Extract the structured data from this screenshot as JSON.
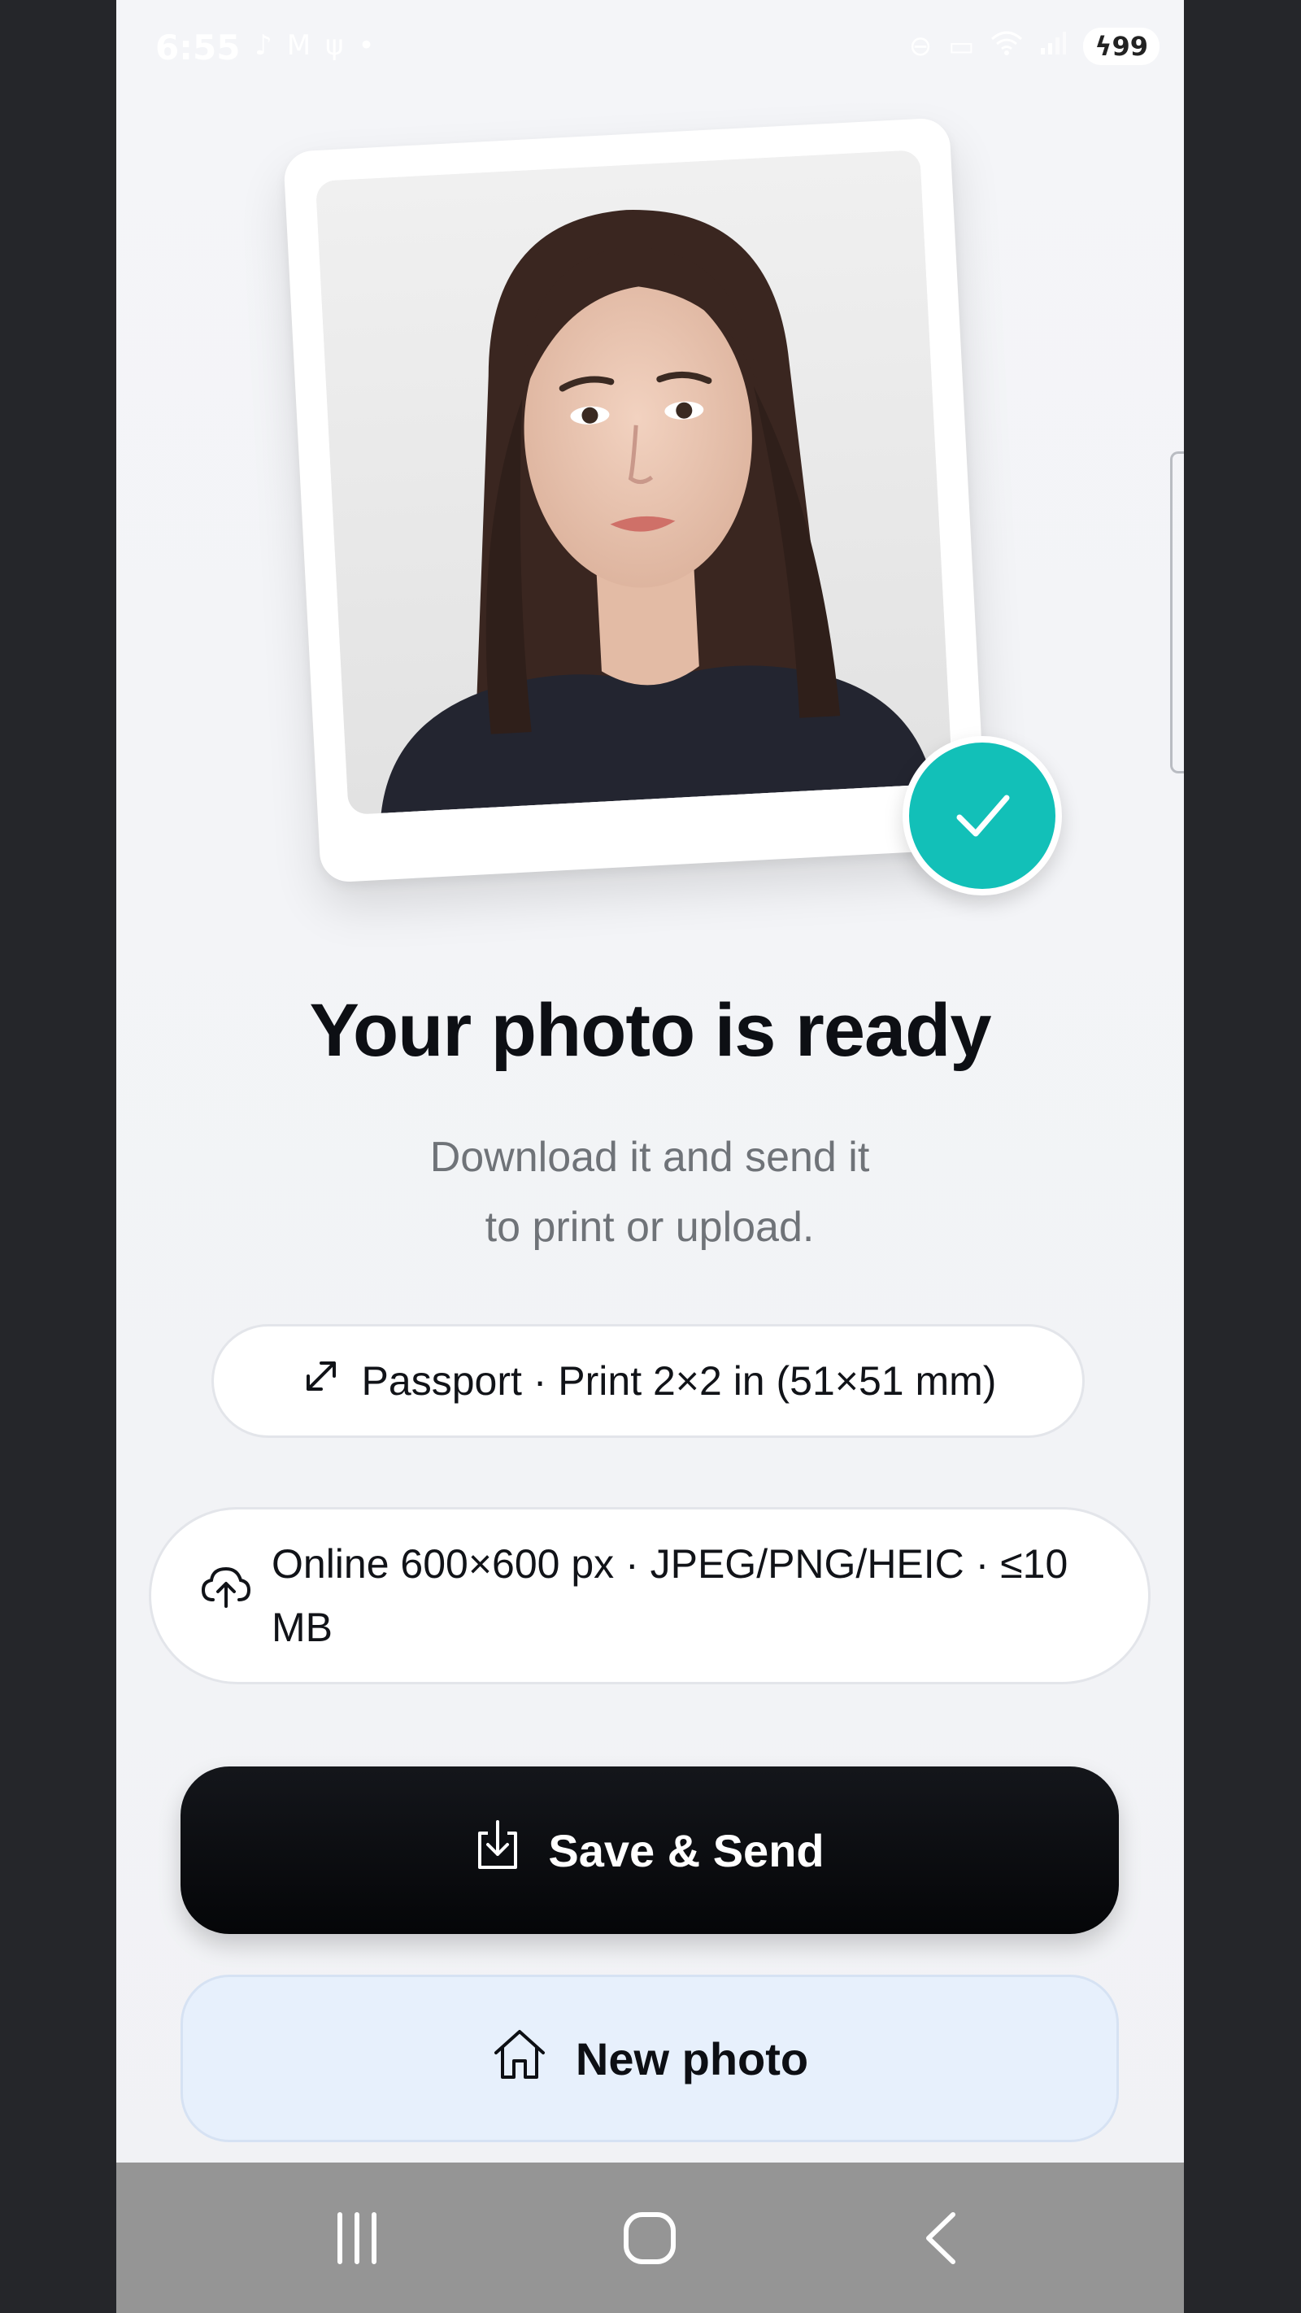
{
  "status_bar": {
    "time": "6:55",
    "battery": "99",
    "left_icons": [
      "tiktok-icon",
      "gmail-icon",
      "usb-icon",
      "dot-icon"
    ],
    "right_icons": [
      "dnd-icon",
      "sleep-icon",
      "wifi-icon",
      "signal-icon",
      "charging-icon"
    ]
  },
  "main": {
    "title": "Your photo is ready",
    "subtitle_line1": "Download it and send it",
    "subtitle_line2": "to print or upload.",
    "passport_spec": "Passport · Print 2×2 in (51×51 mm)",
    "online_spec": "Online 600×600 px · JPEG/PNG/HEIC · ≤10 MB",
    "save_label": "Save & Send",
    "new_label": "New photo"
  },
  "colors": {
    "accent_teal": "#12c0b8",
    "primary_button": "#0a0b0f",
    "secondary_button": "#e7f0fc"
  },
  "icons": {
    "photo_status": "check-icon",
    "passport": "resize-arrows-icon",
    "online": "cloud-upload-icon",
    "save": "download-icon",
    "new": "home-icon"
  }
}
